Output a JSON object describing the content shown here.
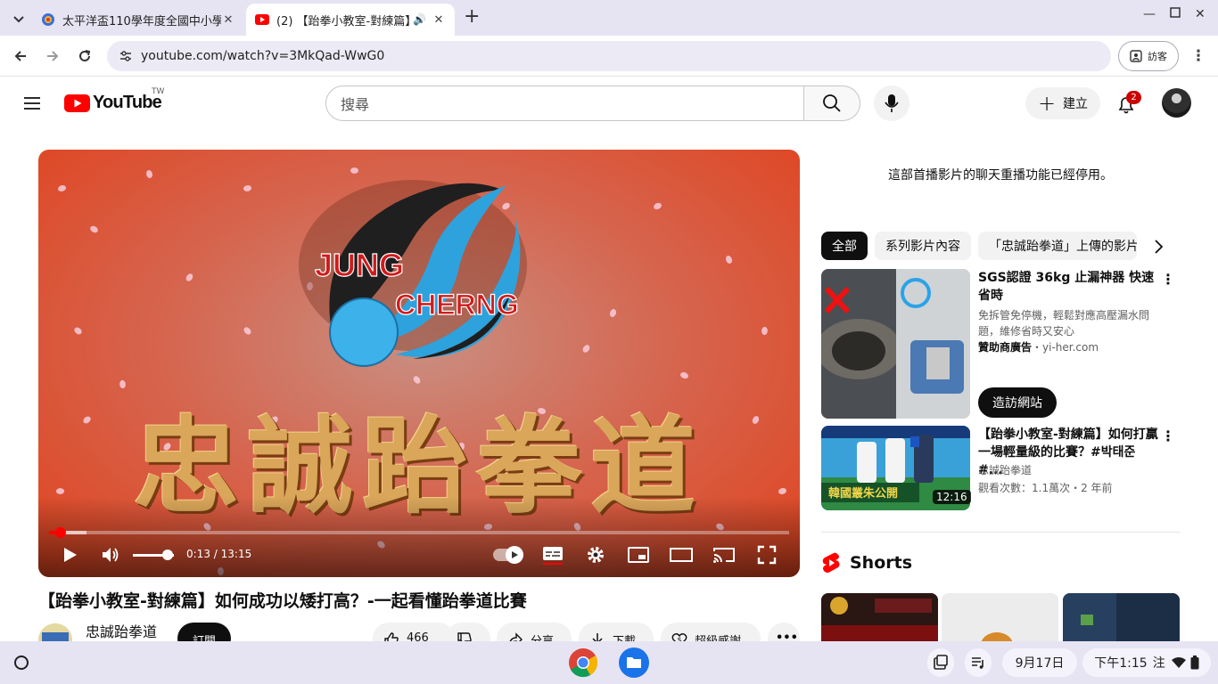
{
  "browser": {
    "tabs": [
      {
        "title": "太平洋盃110學年度全國中小學",
        "active": false
      },
      {
        "title": "(2) 【跆拳小教室-對練篇】",
        "active": true
      }
    ],
    "url": "youtube.com/watch?v=3MkQad-WwG0",
    "guest_label": "訪客"
  },
  "youtube": {
    "logo_word": "YouTube",
    "country_code": "TW",
    "search_placeholder": "搜尋",
    "create_label": "建立",
    "notification_count": "2"
  },
  "player": {
    "current_time": "0:13",
    "duration": "13:15",
    "played_fraction": 0.016,
    "loaded_fraction": 0.05,
    "volume_fraction": 0.85,
    "video_logo_line1": "JUNG",
    "video_logo_line2": "CHERNG",
    "video_kanji": "忠誠跆拳道"
  },
  "video": {
    "title": "【跆拳小教室-對練篇】如何成功以矮打高？-一起看懂跆拳道比賽",
    "channel_name": "忠誠跆拳道",
    "subscribe_label": "訂閱",
    "like_count": "466",
    "share_label": "分享",
    "download_label": "下載",
    "thanks_label": "超級感謝"
  },
  "sidebar": {
    "chat_note": "這部首播影片的聊天重播功能已經停用。",
    "chips": [
      "全部",
      "系列影片內容",
      "「忠誠跆拳道」上傳的影片"
    ],
    "ad": {
      "title": "SGS認證 36kg 止漏神器 快速省時",
      "description": "免拆管免停機，輕鬆對應高壓漏水問題，維修省時又安心",
      "sponsor_label": "贊助商廣告",
      "sponsor_domain": "yi-her.com",
      "visit_label": "造訪網站"
    },
    "related": [
      {
        "title": "【跆拳小教室-對練篇】如何打贏一場輕量級的比賽？#박태준 #...",
        "channel": "忠誠跆拳道",
        "meta": "觀看次數：1.1萬次・2 年前",
        "duration": "12:16",
        "thumb_caption": "韓國叢朱公開"
      }
    ],
    "shorts_label": "Shorts"
  },
  "shelf": {
    "date": "9月17日",
    "time": "下午1:15",
    "ime": "注"
  },
  "colors": {
    "yt_red": "#ff0000",
    "tab_strip": "#e6e4f2",
    "player_bg": "#e0431e"
  }
}
